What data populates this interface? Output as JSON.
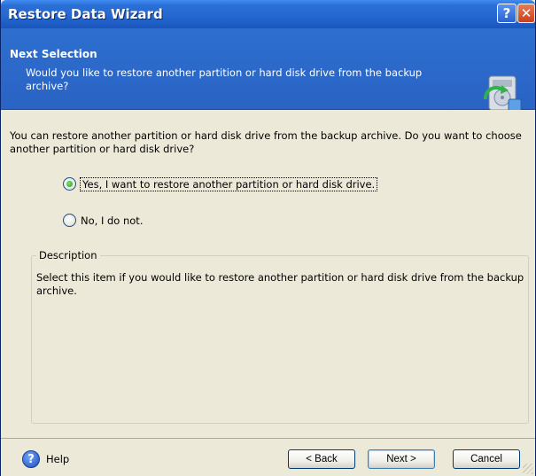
{
  "window": {
    "title": "Restore Data Wizard",
    "help_glyph": "?",
    "close_glyph": "✕"
  },
  "header": {
    "title": "Next Selection",
    "subtitle": "Would you like to restore another partition or hard disk drive from the backup archive?",
    "icon": "backup-restore-icon"
  },
  "content": {
    "intro": "You can restore another partition or hard disk drive from the backup archive. Do you want to choose another partition or hard disk drive?",
    "options": [
      {
        "label": "Yes, I want to restore another partition or hard disk drive.",
        "selected": true
      },
      {
        "label": "No, I do not.",
        "selected": false
      }
    ],
    "description": {
      "legend": "Description",
      "text": "Select this item if you would like to restore another partition or hard disk drive from the backup archive."
    }
  },
  "footer": {
    "help_label": "Help",
    "back_label": "< Back",
    "next_label": "Next >",
    "cancel_label": "Cancel"
  },
  "colors": {
    "title_bar": "#2467d0",
    "header_bg": "#2d6fcf",
    "dialog_bg": "#ece9d8",
    "radio_selected": "#21a11e"
  }
}
